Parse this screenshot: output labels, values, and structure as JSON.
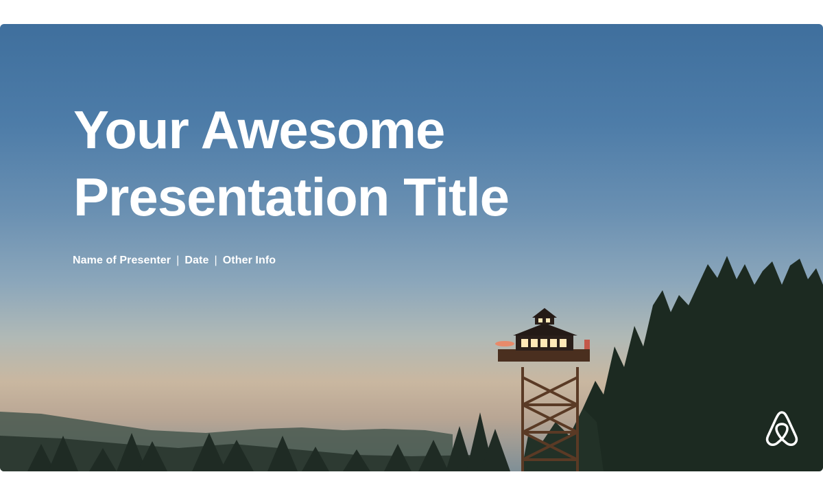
{
  "slide": {
    "title_line1": "Your Awesome",
    "title_line2": "Presentation Title",
    "presenter": "Name of Presenter",
    "date": "Date",
    "other_info": "Other Info",
    "separator": "|"
  },
  "branding": {
    "logo_icon": "airbnb-logo-icon"
  },
  "colors": {
    "sky_top": "#3f6f9d",
    "sky_horizon": "#c9b7a0",
    "forest": "#1e2b22",
    "text": "#ffffff"
  }
}
